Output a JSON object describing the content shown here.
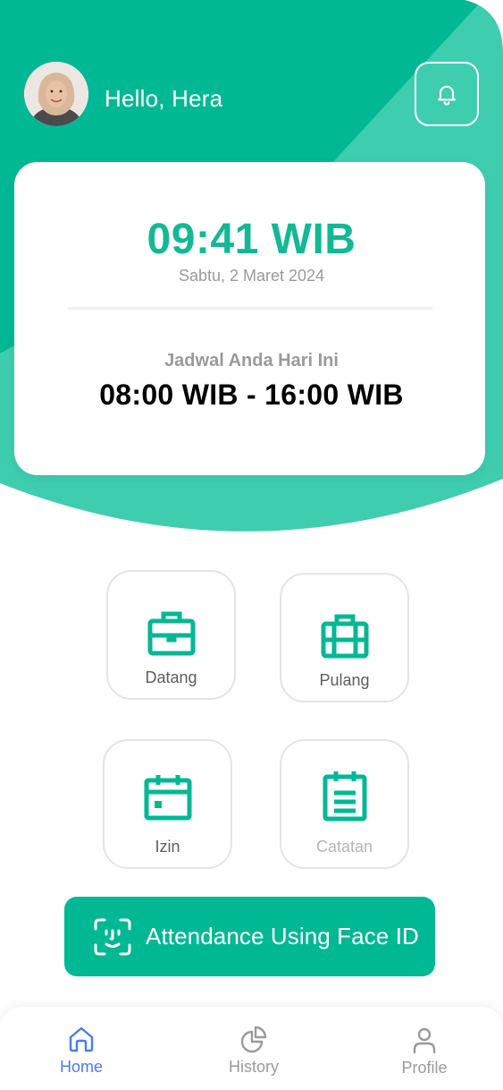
{
  "header": {
    "greeting": "Hello, Hera"
  },
  "clock_card": {
    "time": "09:41 WIB",
    "date": "Sabtu, 2 Maret 2024",
    "schedule_label": "Jadwal Anda Hari Ini",
    "schedule_value": "08:00 WIB -  16:00 WIB"
  },
  "menu": {
    "datang": "Datang",
    "pulang": "Pulang",
    "izin": "Izin",
    "catatan": "Catatan"
  },
  "face_button": {
    "label": "Attendance Using Face ID"
  },
  "tabs": [
    {
      "label": "Home",
      "active": true
    },
    {
      "label": "History",
      "active": false
    },
    {
      "label": "Profile",
      "active": false
    }
  ],
  "colors": {
    "primary": "#00b894",
    "primary_light": "#3fcdb0",
    "tab_active": "#4a7cf0",
    "tab_inactive": "#9a9a9a"
  },
  "icons": {
    "notification": "bell-icon",
    "datang": "briefcase-icon",
    "pulang": "suitcase-icon",
    "izin": "calendar-icon",
    "catatan": "clipboard-icon",
    "face": "face-id-icon",
    "home": "home-icon",
    "history": "pie-chart-icon",
    "profile": "user-icon"
  }
}
